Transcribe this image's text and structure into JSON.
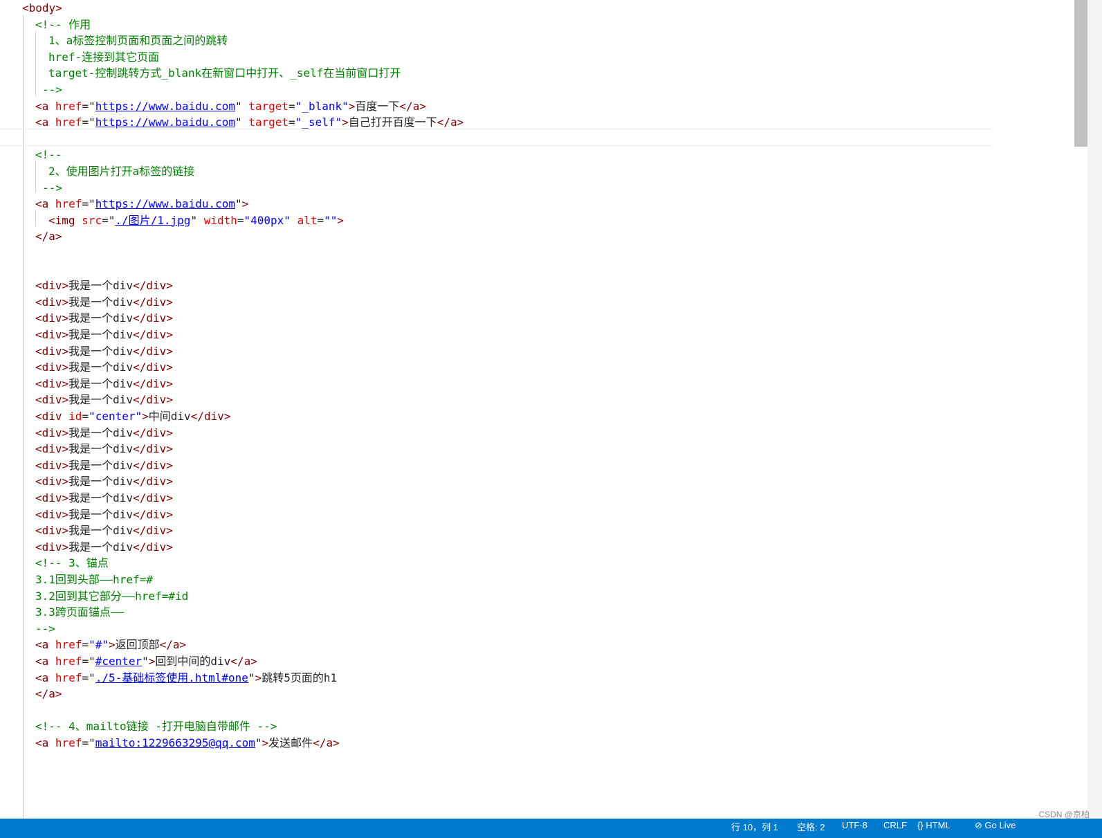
{
  "editor": {
    "lines": [
      [
        [
          "t-tag",
          "<body>"
        ]
      ],
      [
        [
          "t-cm",
          "<!-- 作用"
        ]
      ],
      [
        [
          "t-cm",
          "1、a标签控制页面和页面之间的跳转"
        ]
      ],
      [
        [
          "t-cm",
          "href-连接到其它页面"
        ]
      ],
      [
        [
          "t-cm",
          "target-控制跳转方式_blank在新窗口中打开、_self在当前窗口打开"
        ]
      ],
      [
        [
          "t-cm",
          "-->"
        ]
      ],
      [
        [
          "t-tag",
          "<a "
        ],
        [
          "t-attr",
          "href"
        ],
        [
          "t-txt",
          "=\""
        ],
        [
          "t-url",
          "https://www.baidu.com"
        ],
        [
          "t-txt",
          "\" "
        ],
        [
          "t-attr",
          "target"
        ],
        [
          "t-txt",
          "="
        ],
        [
          "t-str",
          "\"_blank\""
        ],
        [
          "t-tag",
          ">"
        ],
        [
          "t-txt",
          "百度一下"
        ],
        [
          "t-tag",
          "</a>"
        ]
      ],
      [
        [
          "t-tag",
          "<a "
        ],
        [
          "t-attr",
          "href"
        ],
        [
          "t-txt",
          "=\""
        ],
        [
          "t-url",
          "https://www.baidu.com"
        ],
        [
          "t-txt",
          "\" "
        ],
        [
          "t-attr",
          "target"
        ],
        [
          "t-txt",
          "="
        ],
        [
          "t-str",
          "\"_self\""
        ],
        [
          "t-tag",
          ">"
        ],
        [
          "t-txt",
          "自己打开百度一下"
        ],
        [
          "t-tag",
          "</a>"
        ]
      ],
      [],
      [
        [
          "t-cm",
          "<!--"
        ]
      ],
      [
        [
          "t-cm",
          "2、使用图片打开a标签的链接"
        ]
      ],
      [
        [
          "t-cm",
          "-->"
        ]
      ],
      [
        [
          "t-tag",
          "<a "
        ],
        [
          "t-attr",
          "href"
        ],
        [
          "t-txt",
          "=\""
        ],
        [
          "t-url",
          "https://www.baidu.com"
        ],
        [
          "t-txt",
          "\""
        ],
        [
          "t-tag",
          ">"
        ]
      ],
      [
        [
          "t-tag",
          "<img "
        ],
        [
          "t-attr",
          "src"
        ],
        [
          "t-txt",
          "=\""
        ],
        [
          "t-url",
          "./图片/1.jpg"
        ],
        [
          "t-txt",
          "\" "
        ],
        [
          "t-attr",
          "width"
        ],
        [
          "t-txt",
          "="
        ],
        [
          "t-str",
          "\"400px\""
        ],
        [
          "t-txt",
          " "
        ],
        [
          "t-attr",
          "alt"
        ],
        [
          "t-txt",
          "="
        ],
        [
          "t-str",
          "\"\""
        ],
        [
          "t-tag",
          ">"
        ]
      ],
      [
        [
          "t-tag",
          "</a>"
        ]
      ],
      [],
      [],
      [
        [
          "t-tag",
          "<div>"
        ],
        [
          "t-txt",
          "我是一个div"
        ],
        [
          "t-tag",
          "</div>"
        ]
      ],
      [
        [
          "t-tag",
          "<div>"
        ],
        [
          "t-txt",
          "我是一个div"
        ],
        [
          "t-tag",
          "</div>"
        ]
      ],
      [
        [
          "t-tag",
          "<div>"
        ],
        [
          "t-txt",
          "我是一个div"
        ],
        [
          "t-tag",
          "</div>"
        ]
      ],
      [
        [
          "t-tag",
          "<div>"
        ],
        [
          "t-txt",
          "我是一个div"
        ],
        [
          "t-tag",
          "</div>"
        ]
      ],
      [
        [
          "t-tag",
          "<div>"
        ],
        [
          "t-txt",
          "我是一个div"
        ],
        [
          "t-tag",
          "</div>"
        ]
      ],
      [
        [
          "t-tag",
          "<div>"
        ],
        [
          "t-txt",
          "我是一个div"
        ],
        [
          "t-tag",
          "</div>"
        ]
      ],
      [
        [
          "t-tag",
          "<div>"
        ],
        [
          "t-txt",
          "我是一个div"
        ],
        [
          "t-tag",
          "</div>"
        ]
      ],
      [
        [
          "t-tag",
          "<div>"
        ],
        [
          "t-txt",
          "我是一个div"
        ],
        [
          "t-tag",
          "</div>"
        ]
      ],
      [
        [
          "t-tag",
          "<div "
        ],
        [
          "t-attr",
          "id"
        ],
        [
          "t-txt",
          "="
        ],
        [
          "t-str",
          "\"center\""
        ],
        [
          "t-tag",
          ">"
        ],
        [
          "t-txt",
          "中间div"
        ],
        [
          "t-tag",
          "</div>"
        ]
      ],
      [
        [
          "t-tag",
          "<div>"
        ],
        [
          "t-txt",
          "我是一个div"
        ],
        [
          "t-tag",
          "</div>"
        ]
      ],
      [
        [
          "t-tag",
          "<div>"
        ],
        [
          "t-txt",
          "我是一个div"
        ],
        [
          "t-tag",
          "</div>"
        ]
      ],
      [
        [
          "t-tag",
          "<div>"
        ],
        [
          "t-txt",
          "我是一个div"
        ],
        [
          "t-tag",
          "</div>"
        ]
      ],
      [
        [
          "t-tag",
          "<div>"
        ],
        [
          "t-txt",
          "我是一个div"
        ],
        [
          "t-tag",
          "</div>"
        ]
      ],
      [
        [
          "t-tag",
          "<div>"
        ],
        [
          "t-txt",
          "我是一个div"
        ],
        [
          "t-tag",
          "</div>"
        ]
      ],
      [
        [
          "t-tag",
          "<div>"
        ],
        [
          "t-txt",
          "我是一个div"
        ],
        [
          "t-tag",
          "</div>"
        ]
      ],
      [
        [
          "t-tag",
          "<div>"
        ],
        [
          "t-txt",
          "我是一个div"
        ],
        [
          "t-tag",
          "</div>"
        ]
      ],
      [
        [
          "t-tag",
          "<div>"
        ],
        [
          "t-txt",
          "我是一个div"
        ],
        [
          "t-tag",
          "</div>"
        ]
      ],
      [
        [
          "t-cm",
          "<!-- 3、锚点"
        ]
      ],
      [
        [
          "t-cm",
          "3.1回到头部——href=#"
        ]
      ],
      [
        [
          "t-cm",
          "3.2回到其它部分——href=#id"
        ]
      ],
      [
        [
          "t-cm",
          "3.3跨页面锚点——"
        ]
      ],
      [
        [
          "t-cm",
          "-->"
        ]
      ],
      [
        [
          "t-tag",
          "<a "
        ],
        [
          "t-attr",
          "href"
        ],
        [
          "t-txt",
          "="
        ],
        [
          "t-str",
          "\"#\""
        ],
        [
          "t-tag",
          ">"
        ],
        [
          "t-txt",
          "返回顶部"
        ],
        [
          "t-tag",
          "</a>"
        ]
      ],
      [
        [
          "t-tag",
          "<a "
        ],
        [
          "t-attr",
          "href"
        ],
        [
          "t-txt",
          "=\""
        ],
        [
          "t-url",
          "#center"
        ],
        [
          "t-txt",
          "\""
        ],
        [
          "t-tag",
          ">"
        ],
        [
          "t-txt",
          "回到中间的div"
        ],
        [
          "t-tag",
          "</a>"
        ]
      ],
      [
        [
          "t-tag",
          "<a "
        ],
        [
          "t-attr",
          "href"
        ],
        [
          "t-txt",
          "=\""
        ],
        [
          "t-url",
          "./5-基础标签使用.html#one"
        ],
        [
          "t-txt",
          "\""
        ],
        [
          "t-tag",
          ">"
        ],
        [
          "t-txt",
          "跳转5页面的h1"
        ]
      ],
      [
        [
          "t-tag",
          "</a>"
        ]
      ],
      [],
      [
        [
          "t-cm",
          "<!-- 4、mailto链接 -打开电脑自带邮件 -->"
        ]
      ],
      [
        [
          "t-tag",
          "<a "
        ],
        [
          "t-attr",
          "href"
        ],
        [
          "t-txt",
          "=\""
        ],
        [
          "t-url",
          "mailto:1229663295@qq.com"
        ],
        [
          "t-txt",
          "\""
        ],
        [
          "t-tag",
          ">"
        ],
        [
          "t-txt",
          "发送邮件"
        ],
        [
          "t-tag",
          "</a>"
        ]
      ]
    ]
  },
  "statusbar": {
    "position": "行 10，列 1",
    "spaces": "空格: 2",
    "encoding": "UTF-8",
    "eol": "CRLF",
    "language": "{} HTML",
    "go_live": "⊘ Go Live"
  },
  "watermark": "CSDN @京柏"
}
